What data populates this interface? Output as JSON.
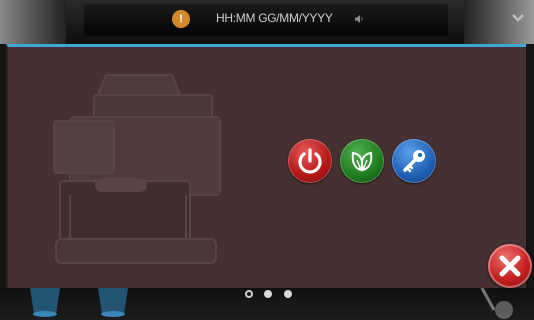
{
  "status_bar": {
    "clock_text": "HH:MM GG/MM/YYYY",
    "warning_icon": "warning-icon",
    "sound_icon": "speaker-icon",
    "menu_icon": "chevron-down-icon"
  },
  "panel": {
    "accent_color": "#3fa6d8",
    "background_color": "#463132",
    "actions": [
      {
        "icon": "power-icon",
        "color": "#c21a1a"
      },
      {
        "icon": "eco-leaf-icon",
        "color": "#1e7a1e"
      },
      {
        "icon": "key-icon",
        "color": "#1d5fb5"
      }
    ]
  },
  "pager": {
    "count": 3,
    "active_index": 0
  },
  "close": {
    "icon": "close-icon",
    "color": "#c42020"
  }
}
